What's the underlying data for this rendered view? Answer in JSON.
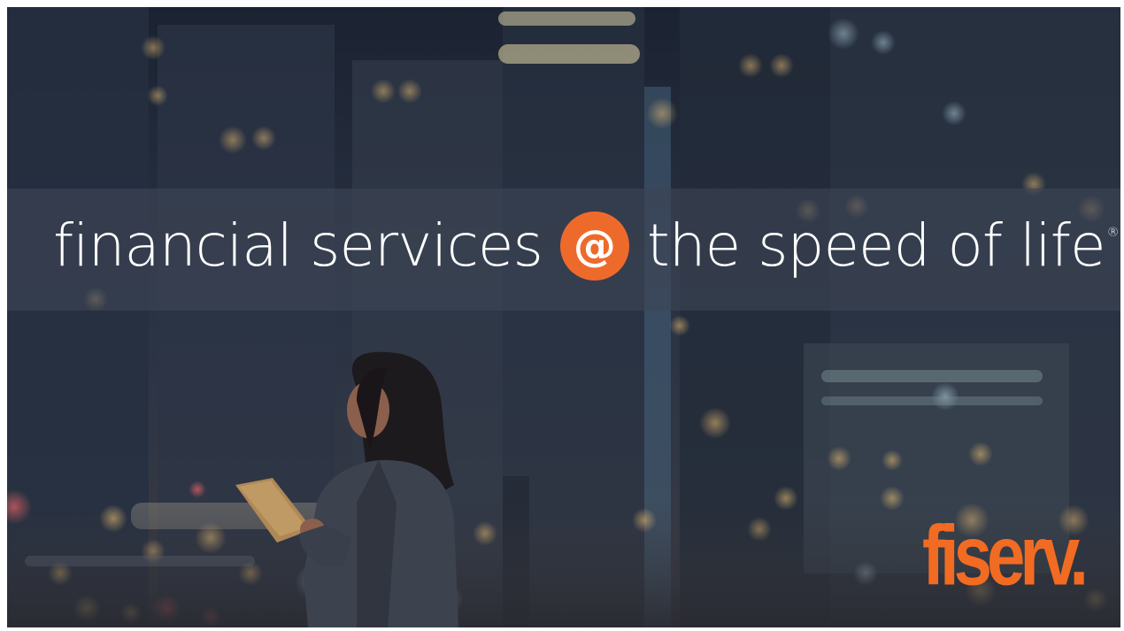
{
  "slide": {
    "tagline": {
      "part1": "financial services",
      "at_symbol": "@",
      "part2": "the speed of life",
      "registered_mark": "®"
    },
    "brand": {
      "logo_text": "fiserv.",
      "accent_color": "#ee6a2b",
      "logo_color": "#f26b22"
    },
    "background": {
      "icon": "city-night-photo"
    }
  }
}
